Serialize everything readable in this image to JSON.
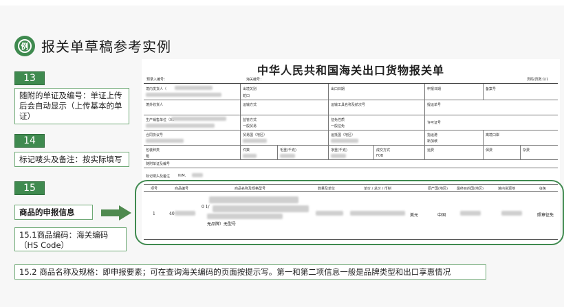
{
  "page": {
    "title": "报关单草稿参考实例",
    "logo_text": "例"
  },
  "left_panel": {
    "item13": {
      "number": "13",
      "note": "随附的单证及编号：单证上传后会自动显示（上传基本的单证）"
    },
    "item14": {
      "number": "14",
      "note": "标记唛头及备注：按实际填写"
    },
    "item15": {
      "number": "15",
      "label": "商品的申报信息"
    },
    "item15_1": {
      "note": "15.1商品编码：海关编码（HS Code）"
    },
    "item15_2": {
      "note": "15.2 商品名称及规格：即申报要素；可在查询海关编码的页面按提示写。第一和第二项信息一般是品牌类型和出口享惠情况"
    }
  },
  "document": {
    "title": "中华人民共和国海关出口货物报关单",
    "pre_entry_no": "预录入编号：",
    "customs_no": "海关编号：",
    "page_info": "页码/页数:1/1",
    "header_fields": [
      "境内发货人（",
      "出境关别",
      "出口日期",
      "申报日期",
      "备案号",
      "境外收货人",
      "运输方式",
      "运输工具名称及航次号",
      "提运单号",
      "生产销售单位（91",
      "监管方式",
      "征免性质",
      "许可证号",
      "合同协议号",
      "贸易国（地区）",
      "运抵国（地区）",
      "指运港",
      "离境口岸",
      "包装种类",
      "件数",
      "毛重(千克)",
      "净重(千克)",
      "成交方式",
      "运费",
      "保费",
      "杂费",
      "随附单证及编号",
      "标记唛头及备注"
    ],
    "header_values": {
      "port": "蛇口",
      "supervision": "一般贸易",
      "exemption": "一般征免",
      "dest_port": "新加坡",
      "packaging": "箱",
      "trade_term": "FOB",
      "marks": "N/M,"
    },
    "goods_columns": [
      "项号",
      "商品编号",
      "商品名称及规格型号",
      "数量及单位",
      "单价 / 总价 / 币制",
      "原产国(地区)",
      "最终目的国(地区)",
      "境内货源地",
      "征免"
    ],
    "goods_row": {
      "item_no": "1",
      "hs_code": "40",
      "name_line1": "0 1/",
      "name_line3": "无品牌）无型号",
      "currency": "美元",
      "origin": "中国",
      "exemption": "照章征免"
    }
  }
}
